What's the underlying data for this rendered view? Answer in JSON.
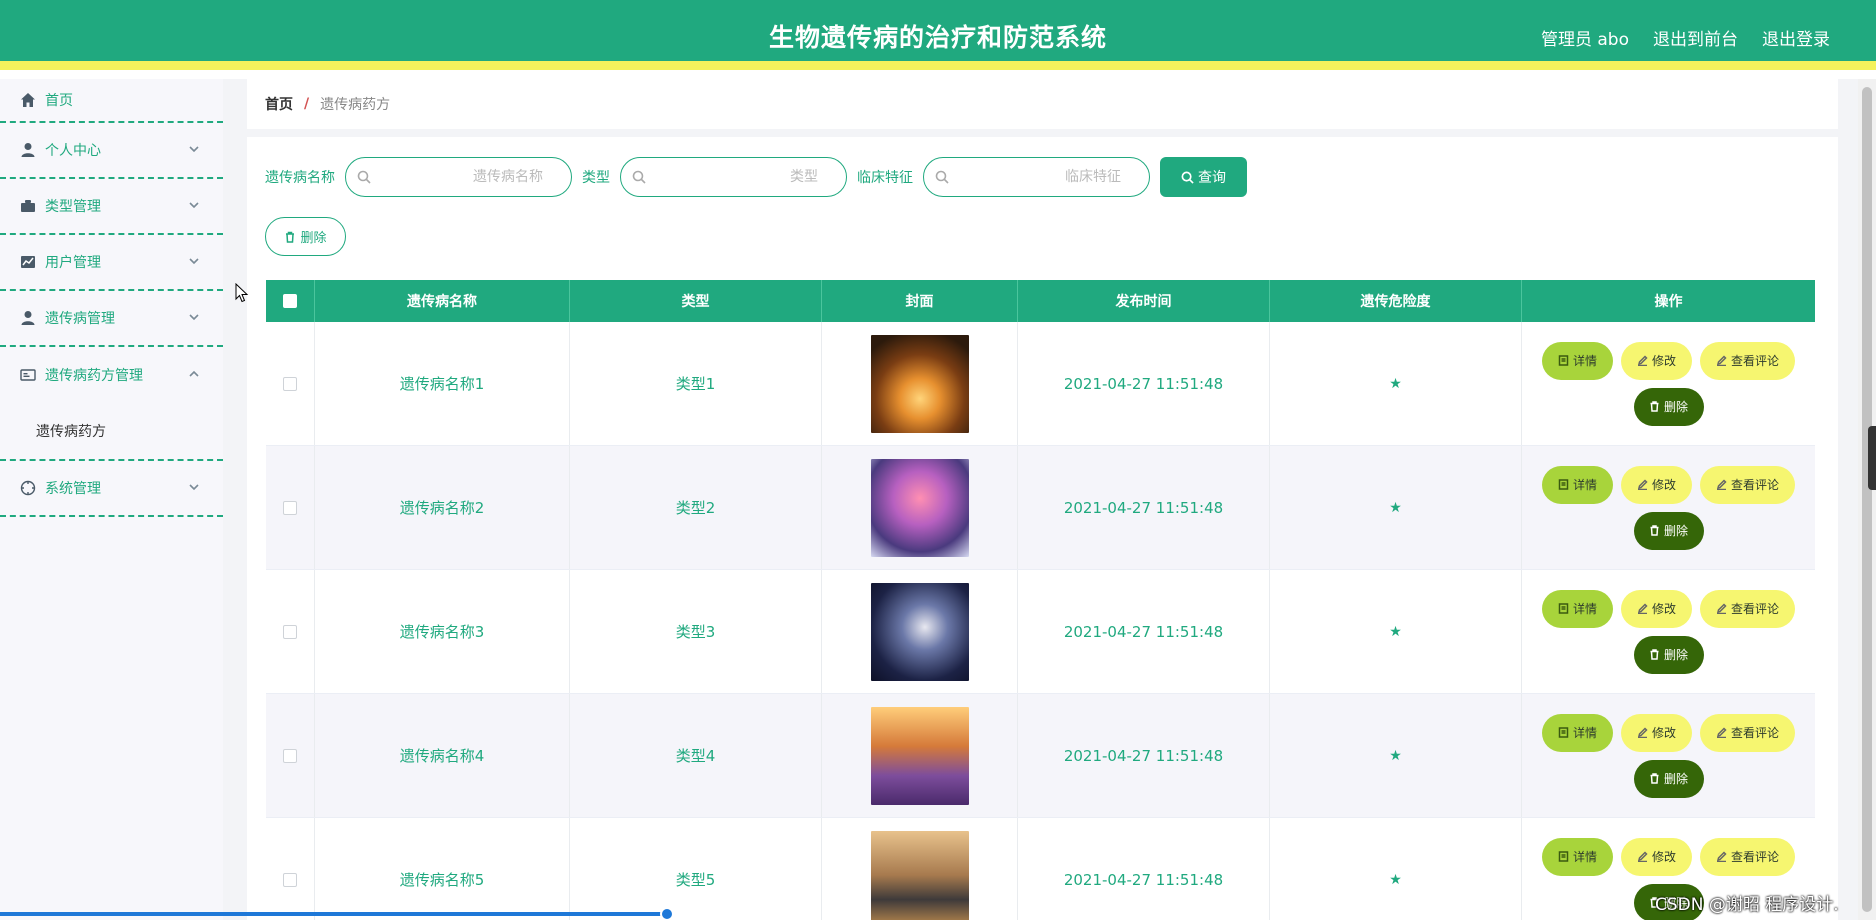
{
  "header": {
    "title": "生物遗传病的治疗和防范系统",
    "user_label": "管理员 abo",
    "to_front": "退出到前台",
    "logout": "退出登录"
  },
  "sidebar": {
    "items": [
      {
        "label": "首页",
        "icon": "home-icon"
      },
      {
        "label": "个人中心",
        "icon": "user-icon"
      },
      {
        "label": "类型管理",
        "icon": "briefcase-icon"
      },
      {
        "label": "用户管理",
        "icon": "chart-icon"
      },
      {
        "label": "遗传病管理",
        "icon": "user-icon"
      },
      {
        "label": "遗传病药方管理",
        "icon": "card-icon",
        "children": [
          "遗传病药方"
        ]
      },
      {
        "label": "系统管理",
        "icon": "compass-icon"
      }
    ]
  },
  "breadcrumb": {
    "home": "首页",
    "sep": "/",
    "current": "遗传病药方"
  },
  "search": {
    "name_label": "遗传病名称",
    "name_placeholder": "遗传病名称",
    "type_label": "类型",
    "type_placeholder": "类型",
    "feature_label": "临床特征",
    "feature_placeholder": "临床特征",
    "query_label": "查询"
  },
  "toolbar": {
    "delete_label": "删除"
  },
  "table": {
    "headers": [
      "遗传病名称",
      "类型",
      "封面",
      "发布时间",
      "遗传危险度",
      "操作"
    ],
    "rows": [
      {
        "name": "遗传病名称1",
        "type": "类型1",
        "time": "2021-04-27 11:51:48",
        "risk": "★"
      },
      {
        "name": "遗传病名称2",
        "type": "类型2",
        "time": "2021-04-27 11:51:48",
        "risk": "★"
      },
      {
        "name": "遗传病名称3",
        "type": "类型3",
        "time": "2021-04-27 11:51:48",
        "risk": "★"
      },
      {
        "name": "遗传病名称4",
        "type": "类型4",
        "time": "2021-04-27 11:51:48",
        "risk": "★"
      },
      {
        "name": "遗传病名称5",
        "type": "类型5",
        "time": "2021-04-27 11:51:48",
        "risk": "★"
      }
    ],
    "actions": {
      "detail": "详情",
      "edit": "修改",
      "comments": "查看评论",
      "delete": "删除"
    }
  },
  "watermark": "CSDN @谢昭 程序设计.",
  "colors": {
    "primary": "#20a97f",
    "accent_yellow": "#f4f25c",
    "detail_btn": "#a8d43b",
    "delete_btn": "#356608"
  }
}
